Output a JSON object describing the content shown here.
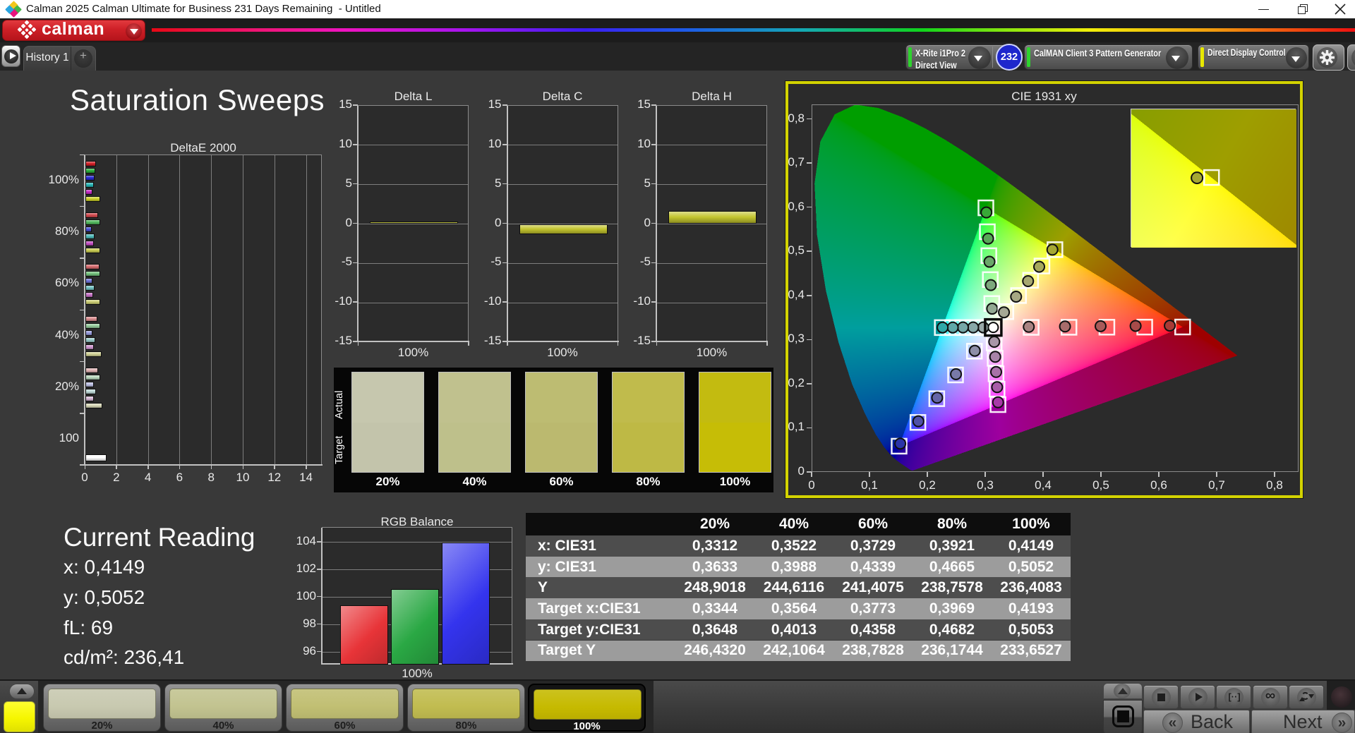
{
  "window": {
    "title": "Calman 2025 Calman Ultimate for Business 231 Days Remaining  - Untitled",
    "controls": {
      "minimize": "minimize",
      "restore": "restore",
      "close": "close"
    }
  },
  "header": {
    "brand": "calman"
  },
  "tabs": {
    "active": "History 1",
    "add": "+"
  },
  "toolbar": {
    "meter": {
      "line1": "X-Rite i1Pro 2",
      "line2": "Direct View",
      "badge": "232",
      "accent": "#2ed32e"
    },
    "pattern_generator": {
      "label": "CalMAN Client 3 Pattern Generator",
      "accent": "#2ed32e"
    },
    "display_control": {
      "label": "Direct Display Control",
      "accent": "#e8e800"
    }
  },
  "page": {
    "title": "Saturation Sweeps"
  },
  "deltae_chart": {
    "type": "bar",
    "title": "DeltaE 2000",
    "x_ticks": [
      "0",
      "2",
      "4",
      "6",
      "8",
      "10",
      "12",
      "14"
    ],
    "xlim": [
      0,
      15
    ],
    "group_labels": [
      "100%",
      "80%",
      "60%",
      "40%",
      "20%",
      "100"
    ],
    "groups": [
      {
        "label": "100%",
        "values": [
          0.68,
          0.63,
          0.6,
          0.55,
          0.46,
          0.93
        ],
        "colors": [
          "#d42027",
          "#2cb13c",
          "#2a2ad4",
          "#27b7b7",
          "#c72ac7",
          "#cdd22b"
        ]
      },
      {
        "label": "80%",
        "values": [
          0.8,
          0.93,
          0.38,
          0.6,
          0.55,
          0.93
        ],
        "colors": [
          "#d4494e",
          "#52b95e",
          "#4a50d8",
          "#4fbcbc",
          "#c44fc4",
          "#c9cc52"
        ]
      },
      {
        "label": "60%",
        "values": [
          0.88,
          0.94,
          0.43,
          0.56,
          0.5,
          0.94
        ],
        "colors": [
          "#d86c6f",
          "#74c37d",
          "#7277dc",
          "#74c4c4",
          "#c974c9",
          "#cdcf74"
        ]
      },
      {
        "label": "40%",
        "values": [
          0.75,
          0.92,
          0.46,
          0.63,
          0.52,
          1.01
        ],
        "colors": [
          "#dc8f91",
          "#97cd9d",
          "#989cdf",
          "#9accca",
          "#cf97cf",
          "#d2d396"
        ]
      },
      {
        "label": "20%",
        "values": [
          0.78,
          0.94,
          0.52,
          0.66,
          0.55,
          1.08
        ],
        "colors": [
          "#e0b3b4",
          "#bad7bd",
          "#bdc0e5",
          "#bedad8",
          "#d7bad7",
          "#d9d9b8"
        ]
      },
      {
        "label": "100",
        "values": [
          1.35
        ],
        "colors": [
          "#ffffff"
        ]
      }
    ]
  },
  "delta_charts": {
    "type": "bar",
    "ylim": [
      -15,
      15
    ],
    "y_ticks": [
      "15",
      "10",
      "5",
      "0",
      "-5",
      "-10",
      "-15"
    ],
    "x_label": "100%",
    "bar_color": "#c3c52f",
    "items": [
      {
        "title": "Delta L",
        "value": 0.32
      },
      {
        "title": "Delta C",
        "value": -1.25
      },
      {
        "title": "Delta H",
        "value": 1.62
      }
    ]
  },
  "patch_strip": {
    "row_labels": [
      "Actual",
      "Target"
    ],
    "patches": [
      {
        "label": "20%",
        "actual": "#c6c7ae",
        "target": "#c3c4ab"
      },
      {
        "label": "40%",
        "actual": "#c0c18e",
        "target": "#bec08b"
      },
      {
        "label": "60%",
        "actual": "#bdbc72",
        "target": "#bbb96f"
      },
      {
        "label": "80%",
        "actual": "#c0bb4c",
        "target": "#beb945"
      },
      {
        "label": "100%",
        "actual": "#c3bb10",
        "target": "#c6bd06"
      }
    ]
  },
  "cie_chart": {
    "type": "scatter",
    "title": "CIE 1931 xy",
    "x_ticks": [
      "0",
      "0,1",
      "0,2",
      "0,3",
      "0,4",
      "0,5",
      "0,6",
      "0,7",
      "0,8"
    ],
    "y_ticks": [
      "0",
      "0,1",
      "0,2",
      "0,3",
      "0,4",
      "0,5",
      "0,6",
      "0,7",
      "0,8"
    ],
    "xlim": [
      0,
      0.8415
    ],
    "ylim": [
      0,
      0.8327
    ],
    "border_color": "#d3d300",
    "gamut_triangle": {
      "red": [
        0.64,
        0.33
      ],
      "green": [
        0.3,
        0.6
      ],
      "blue": [
        0.15,
        0.06
      ]
    },
    "white_point": [
      0.3127,
      0.329
    ],
    "sweeps": [
      {
        "name": "red",
        "targets": [
          [
            0.3782,
            0.3292
          ],
          [
            0.4436,
            0.3294
          ],
          [
            0.5091,
            0.3296
          ],
          [
            0.5745,
            0.3298
          ],
          [
            0.64,
            0.33
          ]
        ],
        "measured": [
          [
            0.3741,
            0.3304
          ],
          [
            0.4367,
            0.3312
          ],
          [
            0.4982,
            0.3319
          ],
          [
            0.5587,
            0.3325
          ],
          [
            0.6178,
            0.3331
          ]
        ]
      },
      {
        "name": "green",
        "targets": [
          [
            0.3102,
            0.3832
          ],
          [
            0.3076,
            0.4374
          ],
          [
            0.3051,
            0.4916
          ],
          [
            0.3025,
            0.5458
          ],
          [
            0.3,
            0.6
          ]
        ],
        "measured": [
          [
            0.3108,
            0.3715
          ],
          [
            0.3085,
            0.4249
          ],
          [
            0.3062,
            0.4778
          ],
          [
            0.3038,
            0.5303
          ],
          [
            0.3008,
            0.5895
          ]
        ]
      },
      {
        "name": "blue",
        "targets": [
          [
            0.2802,
            0.2752
          ],
          [
            0.2476,
            0.2214
          ],
          [
            0.2151,
            0.1676
          ],
          [
            0.1825,
            0.1138
          ],
          [
            0.15,
            0.06
          ]
        ],
        "measured": [
          [
            0.2808,
            0.2762
          ],
          [
            0.2483,
            0.2232
          ],
          [
            0.2158,
            0.1698
          ],
          [
            0.1833,
            0.1164
          ],
          [
            0.152,
            0.0658
          ]
        ]
      },
      {
        "name": "cyan",
        "targets": [
          [
            0.2951,
            0.3289
          ],
          [
            0.2775,
            0.3288
          ],
          [
            0.2599,
            0.3288
          ],
          [
            0.2423,
            0.3287
          ],
          [
            0.2246,
            0.3287
          ]
        ],
        "measured": [
          [
            0.2955,
            0.3291
          ],
          [
            0.278,
            0.329
          ],
          [
            0.2604,
            0.329
          ],
          [
            0.2428,
            0.3289
          ],
          [
            0.2252,
            0.3289
          ]
        ]
      },
      {
        "name": "magenta",
        "targets": [
          [
            0.3143,
            0.294
          ],
          [
            0.316,
            0.2591
          ],
          [
            0.3176,
            0.2241
          ],
          [
            0.3193,
            0.1892
          ],
          [
            0.3209,
            0.1542
          ]
        ],
        "measured": [
          [
            0.3144,
            0.2965
          ],
          [
            0.3161,
            0.2625
          ],
          [
            0.3177,
            0.2282
          ],
          [
            0.3194,
            0.1938
          ],
          [
            0.321,
            0.1594
          ]
        ]
      },
      {
        "name": "yellow",
        "targets": [
          [
            0.3344,
            0.3648
          ],
          [
            0.3564,
            0.4013
          ],
          [
            0.3773,
            0.4358
          ],
          [
            0.3969,
            0.4682
          ],
          [
            0.4193,
            0.5053
          ]
        ],
        "measured": [
          [
            0.3312,
            0.3633
          ],
          [
            0.3522,
            0.3988
          ],
          [
            0.3729,
            0.4339
          ],
          [
            0.3921,
            0.4665
          ],
          [
            0.4149,
            0.5052
          ]
        ]
      }
    ],
    "inset": {
      "x_range": [
        0.395,
        0.445
      ],
      "y_center": 0.505,
      "target": [
        0.4193,
        0.5053
      ],
      "measured": [
        0.4149,
        0.5052
      ]
    }
  },
  "current_reading": {
    "title": "Current Reading",
    "lines": [
      "x: 0,4149",
      "y: 0,5052",
      "fL: 69",
      "cd/m²: 236,41"
    ]
  },
  "rgb_balance": {
    "type": "bar",
    "title": "RGB Balance",
    "y_ticks": [
      "104",
      "102",
      "100",
      "98",
      "96"
    ],
    "ylim": [
      95.1,
      105.07
    ],
    "x_label": "100%",
    "categories": [
      "Red",
      "Green",
      "Blue"
    ],
    "values": [
      99.4,
      100.6,
      104.0
    ],
    "colors": [
      "#e83438",
      "#2aa844",
      "#3434ee"
    ]
  },
  "data_table": {
    "columns": [
      "",
      "20%",
      "40%",
      "60%",
      "80%",
      "100%"
    ],
    "rows": [
      {
        "label": "x: CIE31",
        "values": [
          "0,3312",
          "0,3522",
          "0,3729",
          "0,3921",
          "0,4149"
        ]
      },
      {
        "label": "y: CIE31",
        "values": [
          "0,3633",
          "0,3988",
          "0,4339",
          "0,4665",
          "0,5052"
        ]
      },
      {
        "label": "Y",
        "values": [
          "248,9018",
          "244,6116",
          "241,4075",
          "238,7578",
          "236,4083"
        ]
      },
      {
        "label": "Target x:CIE31",
        "values": [
          "0,3344",
          "0,3564",
          "0,3773",
          "0,3969",
          "0,4193"
        ]
      },
      {
        "label": "Target y:CIE31",
        "values": [
          "0,3648",
          "0,4013",
          "0,4358",
          "0,4682",
          "0,5053"
        ]
      },
      {
        "label": "Target Y",
        "values": [
          "246,4320",
          "242,1064",
          "238,7828",
          "236,1744",
          "233,6527"
        ]
      }
    ]
  },
  "bottom_bar": {
    "swatch_color": "#f6f600",
    "patch_buttons": [
      {
        "label": "20%",
        "color": "#c8c9b0",
        "selected": false
      },
      {
        "label": "40%",
        "color": "#c2c390",
        "selected": false
      },
      {
        "label": "60%",
        "color": "#c1bf73",
        "selected": false
      },
      {
        "label": "80%",
        "color": "#c1bc50",
        "selected": false
      },
      {
        "label": "100%",
        "color": "#c6ba00",
        "selected": true
      }
    ],
    "transport": [
      "stop",
      "play",
      "bracket-dots",
      "infinity",
      "refresh"
    ],
    "back_label": "Back",
    "next_label": "Next",
    "back_glyph": "«",
    "next_glyph": "»",
    "infinity_glyph": "∞",
    "bracket_glyph": "[··]"
  }
}
